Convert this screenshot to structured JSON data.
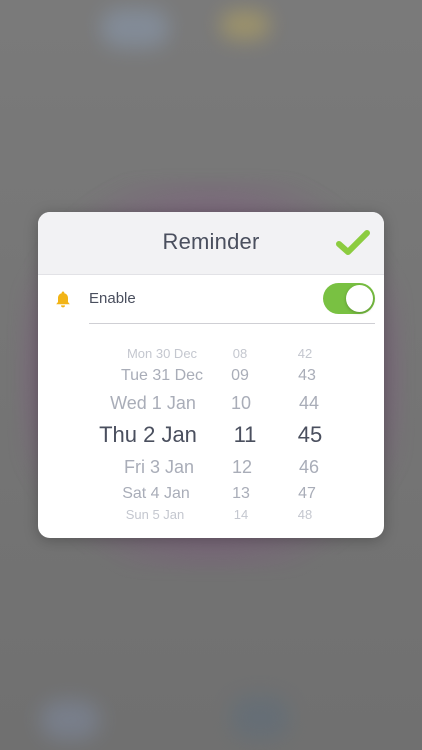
{
  "dialog": {
    "title": "Reminder",
    "enable_label": "Enable",
    "enabled": true
  },
  "picker": {
    "days": [
      "Mon 30 Dec",
      "Tue 31 Dec",
      "Wed 1 Jan",
      "Thu 2 Jan",
      "Fri 3 Jan",
      "Sat 4 Jan",
      "Sun 5 Jan"
    ],
    "hours": [
      "08",
      "09",
      "10",
      "11",
      "12",
      "13",
      "14"
    ],
    "minutes": [
      "42",
      "43",
      "44",
      "45",
      "46",
      "47",
      "48"
    ],
    "selected": {
      "day": "Thu 2 Jan",
      "hour": "11",
      "minute": "45"
    }
  },
  "colors": {
    "accent_green": "#79c142",
    "bell_yellow": "#f2b416"
  },
  "icons": {
    "confirm": "checkmark-icon",
    "bell": "bell-icon"
  }
}
